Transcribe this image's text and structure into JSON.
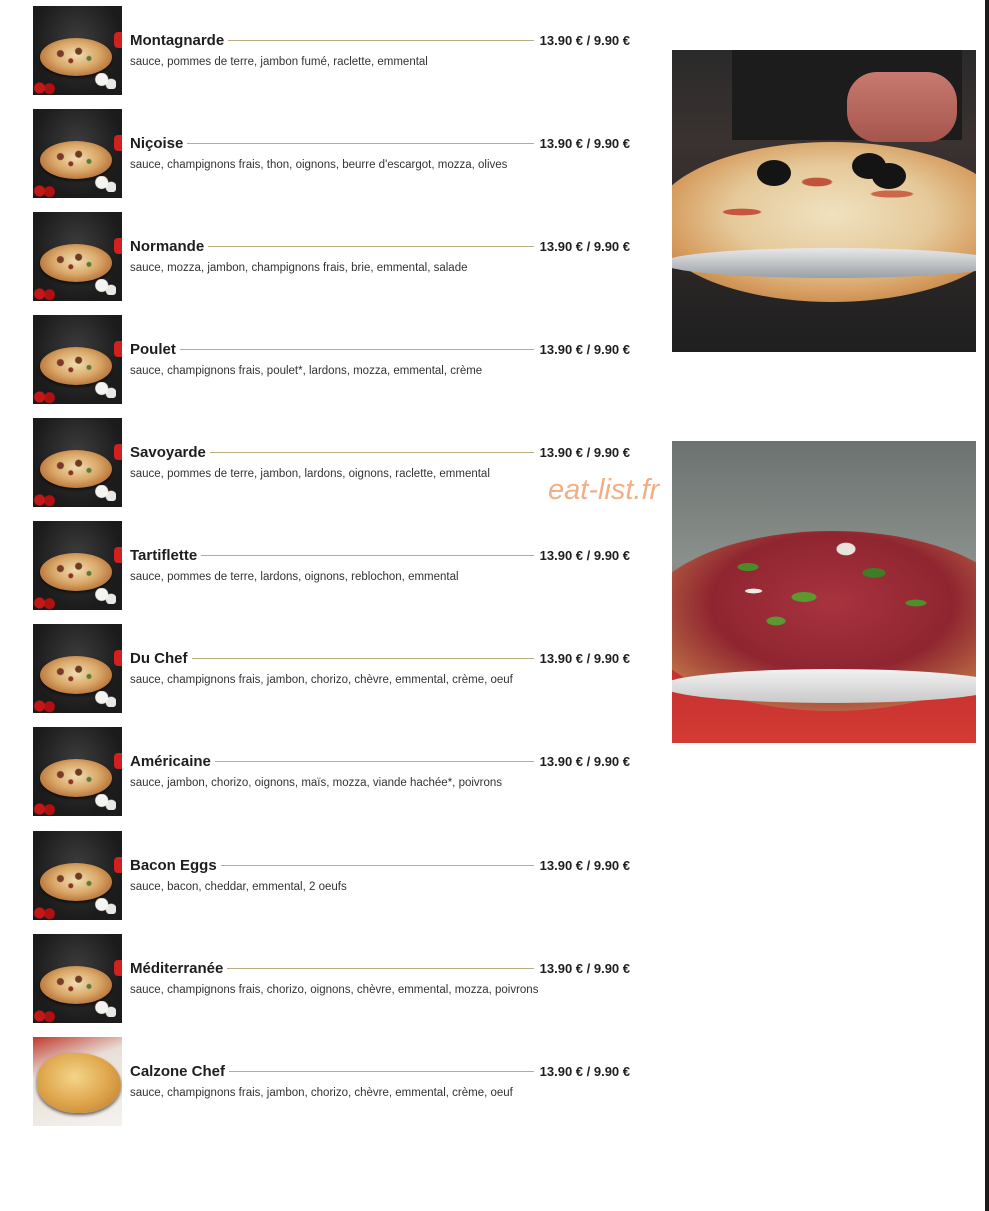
{
  "menu": {
    "items": [
      {
        "name": "Montagnarde",
        "price": "13.90 € / 9.90 €",
        "description": "sauce, pommes de terre, jambon fumé, raclette, emmental",
        "image": "pizza-photo"
      },
      {
        "name": "Niçoise",
        "price": "13.90 € / 9.90 €",
        "description": "sauce, champignons frais, thon, oignons, beurre d'escargot, mozza, olives",
        "image": "pizza-photo"
      },
      {
        "name": "Normande",
        "price": "13.90 € / 9.90 €",
        "description": "sauce, mozza, jambon, champignons frais, brie, emmental, salade",
        "image": "pizza-photo"
      },
      {
        "name": "Poulet",
        "price": "13.90 € / 9.90 €",
        "description": "sauce, champignons frais, poulet*, lardons, mozza, emmental, crème",
        "image": "pizza-photo"
      },
      {
        "name": "Savoyarde",
        "price": "13.90 € / 9.90 €",
        "description": "sauce, pommes de terre, jambon, lardons, oignons, raclette, emmental",
        "image": "pizza-photo"
      },
      {
        "name": "Tartiflette",
        "price": "13.90 € / 9.90 €",
        "description": "sauce, pommes de terre, lardons, oignons, reblochon, emmental",
        "image": "pizza-photo"
      },
      {
        "name": "Du Chef",
        "price": "13.90 € / 9.90 €",
        "description": "sauce, champignons frais, jambon, chorizo, chèvre, emmental, crème, oeuf",
        "image": "pizza-photo"
      },
      {
        "name": "Américaine",
        "price": "13.90 € / 9.90 €",
        "description": "sauce, jambon, chorizo, oignons, maïs, mozza, viande hachée*, poivrons",
        "image": "pizza-photo"
      },
      {
        "name": "Bacon Eggs",
        "price": "13.90 € / 9.90 €",
        "description": "sauce, bacon, cheddar, emmental, 2 oeufs",
        "image": "pizza-photo"
      },
      {
        "name": "Méditerranée",
        "price": "13.90 € / 9.90 €",
        "description": "sauce, champignons frais, chorizo, oignons, chèvre, emmental, mozza, poivrons",
        "image": "pizza-photo"
      },
      {
        "name": "Calzone Chef",
        "price": "13.90 € / 9.90 €",
        "description": "sauce, champignons frais, jambon, chorizo, chèvre, emmental, crème, oeuf",
        "image": "calzone-photo"
      }
    ]
  },
  "watermark": "eat-list.fr",
  "colors": {
    "leader_line": "#b9ae82",
    "watermark": "#f0a070",
    "text": "#1e1e1e"
  }
}
